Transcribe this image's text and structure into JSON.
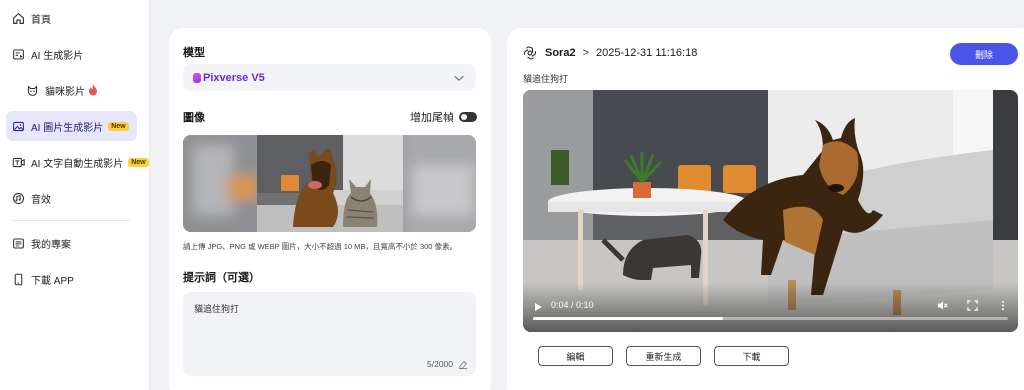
{
  "sidebar": {
    "items": [
      {
        "label": "首頁",
        "icon": "home-icon"
      },
      {
        "label": "AI 生成影片",
        "icon": "video-list-icon"
      },
      {
        "label": "貓咪影片",
        "icon": "cat-icon",
        "suffix_icon": "fire-icon"
      },
      {
        "label": "AI 圖片生成影片",
        "icon": "image-to-video-icon",
        "badge": "New"
      },
      {
        "label": "AI 文字自動生成影片",
        "icon": "text-to-video-icon",
        "badge": "New"
      },
      {
        "label": "音效",
        "icon": "sound-icon"
      },
      {
        "label": "我的專案",
        "icon": "projects-icon"
      },
      {
        "label": "下載 APP",
        "icon": "phone-icon"
      }
    ]
  },
  "form": {
    "model_label": "模型",
    "model_value": "Pixverse V5",
    "image_label": "圖像",
    "tail_frame_label": "增加尾幀",
    "tail_frame_on": false,
    "upload_hint": "請上傳 JPG、PNG 或 WEBP 圖片，大小不超過 10 MB，且寬高不小於 300 像素。",
    "prompt_label": "提示詞（可選）",
    "prompt_value": "貓追住狗打",
    "prompt_count": "5/2000"
  },
  "result": {
    "model": "Sora2",
    "separator": ">",
    "timestamp": "2025-12-31 11:16:18",
    "delete_label": "刪除",
    "prompt": "貓追住狗打",
    "video": {
      "time": "0:04 / 0:10",
      "progress": 0.4,
      "muted": true
    },
    "actions": {
      "edit": "編輯",
      "regenerate": "重新生成",
      "download": "下載"
    }
  },
  "colors": {
    "accent": "#4a55e8",
    "active_nav_bg": "#e6e7fb",
    "badge": "#ffcf3a",
    "model_name": "#6a2bd9"
  }
}
